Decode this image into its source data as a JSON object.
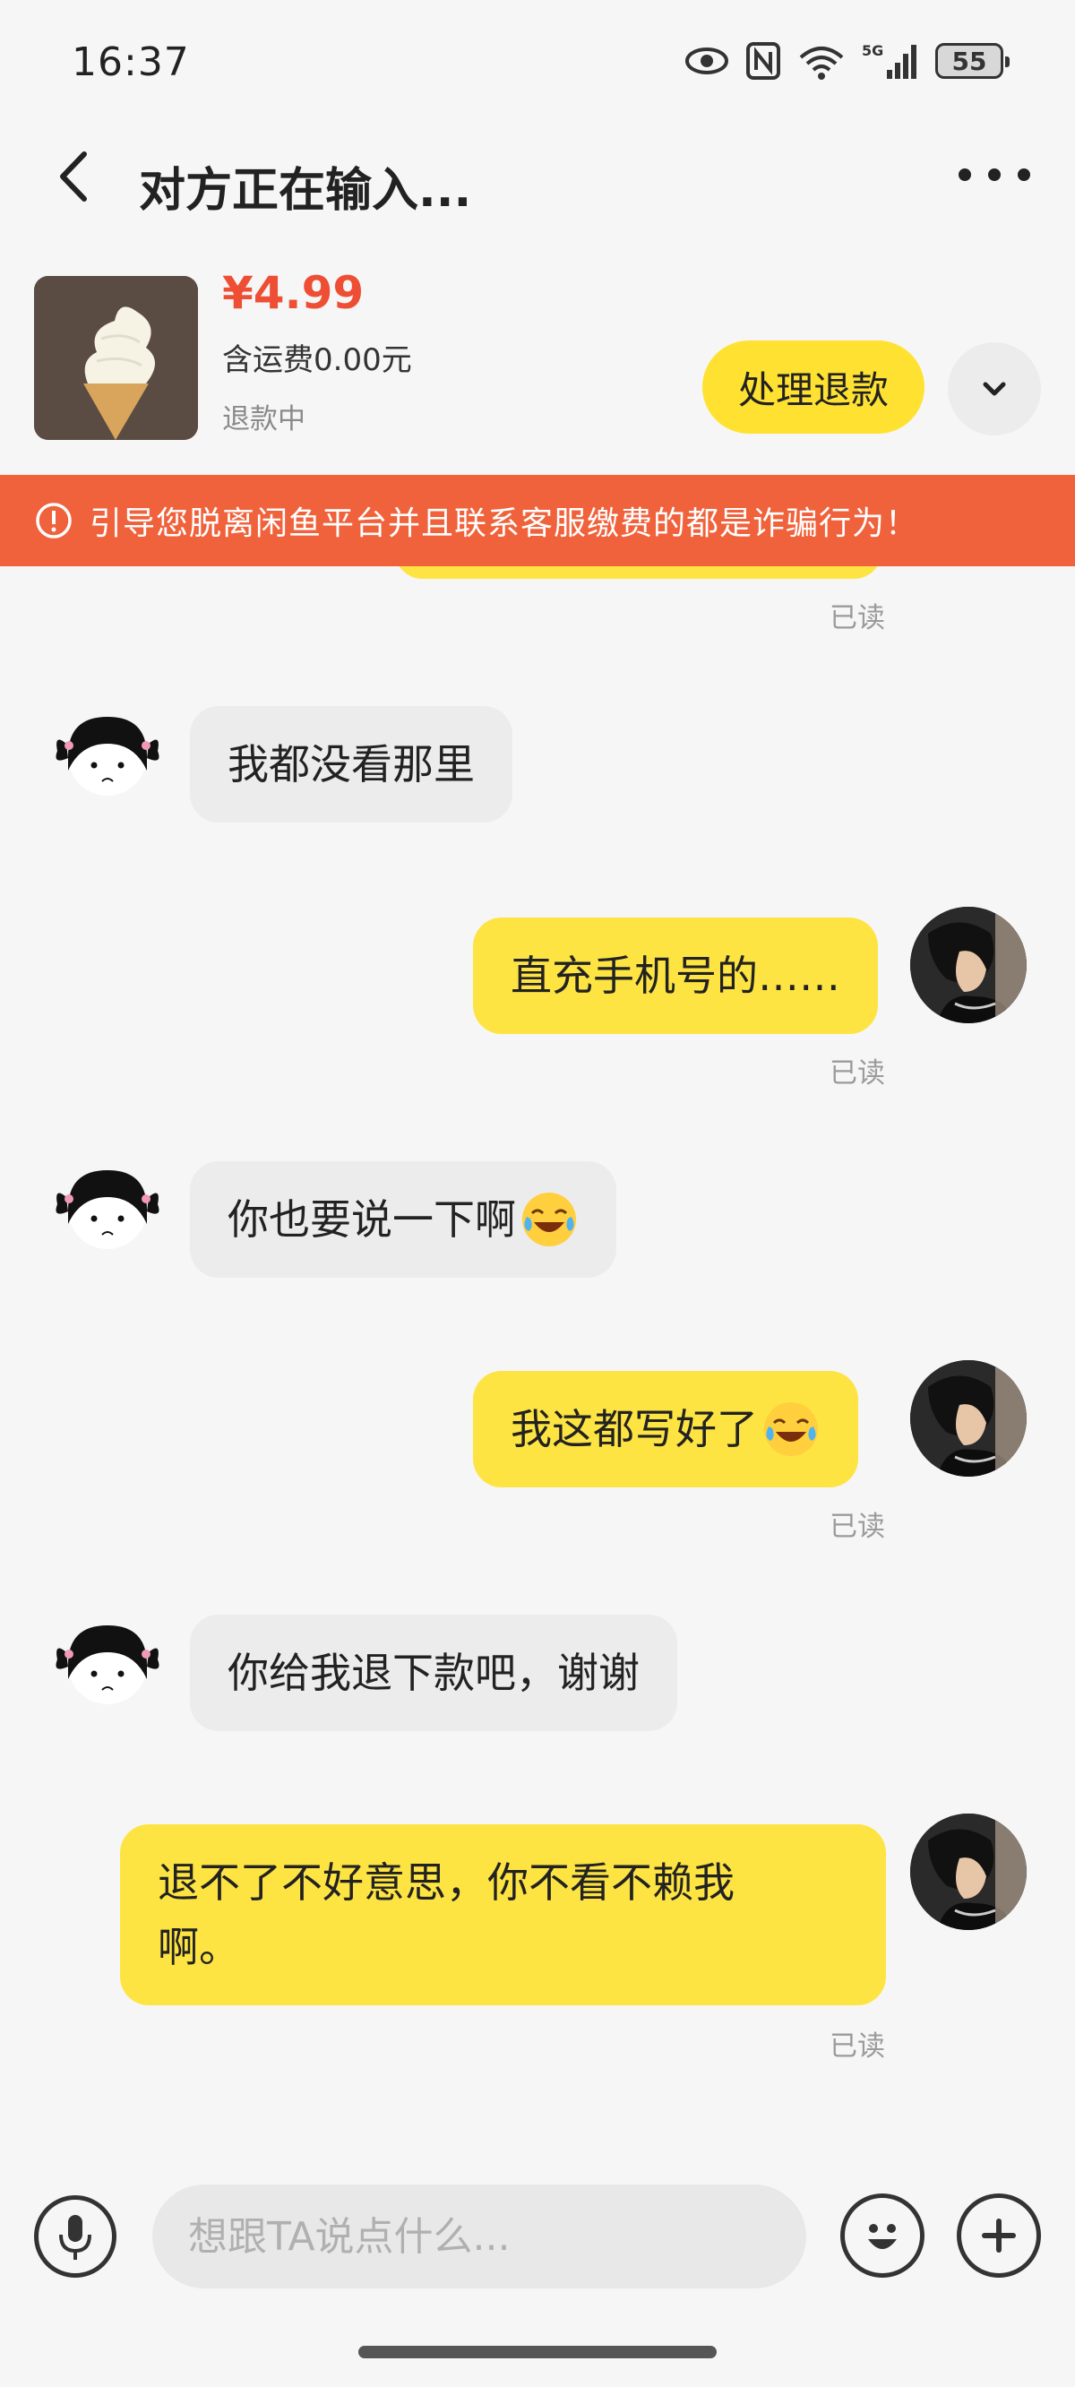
{
  "status_bar": {
    "time": "16:37",
    "battery": "55",
    "icons": [
      "eye-icon",
      "nfc-icon",
      "wifi-6-icon",
      "5g-signal-icon",
      "battery-icon"
    ]
  },
  "header": {
    "title": "对方正在输入...",
    "back_icon": "chevron-left-icon",
    "more_icon": "more-dots-icon"
  },
  "product": {
    "price": "¥4.99",
    "shipping": "含运费0.00元",
    "status": "退款中",
    "refund_button": "处理退款",
    "image_subject": "soft-serve ice cream cone"
  },
  "warning": {
    "text": "引导您脱离闲鱼平台并且联系客服缴费的都是诈骗行为！",
    "color": "#f0623b"
  },
  "messages": [
    {
      "side": "outgoing",
      "read": "已读"
    },
    {
      "side": "incoming",
      "text": "我都没看那里"
    },
    {
      "side": "outgoing",
      "text": "直充手机号的……",
      "read": "已读"
    },
    {
      "side": "incoming",
      "text": "你也要说一下啊",
      "emoji": "crying-laughing-emoji"
    },
    {
      "side": "outgoing",
      "text": "我这都写好了",
      "emoji": "crying-laughing-emoji",
      "read": "已读"
    },
    {
      "side": "incoming",
      "text": "你给我退下款吧，谢谢"
    },
    {
      "side": "outgoing",
      "text_line1": "退不了不好意思，你不看不赖我",
      "text_line2": "啊。",
      "read": "已读"
    }
  ],
  "input_bar": {
    "placeholder": "想跟TA说点什么..."
  },
  "colors": {
    "accent_yellow": "#ffe231",
    "outgoing_bubble": "#fde443",
    "incoming_bubble": "#ececec",
    "price_red": "#ee4e34"
  }
}
